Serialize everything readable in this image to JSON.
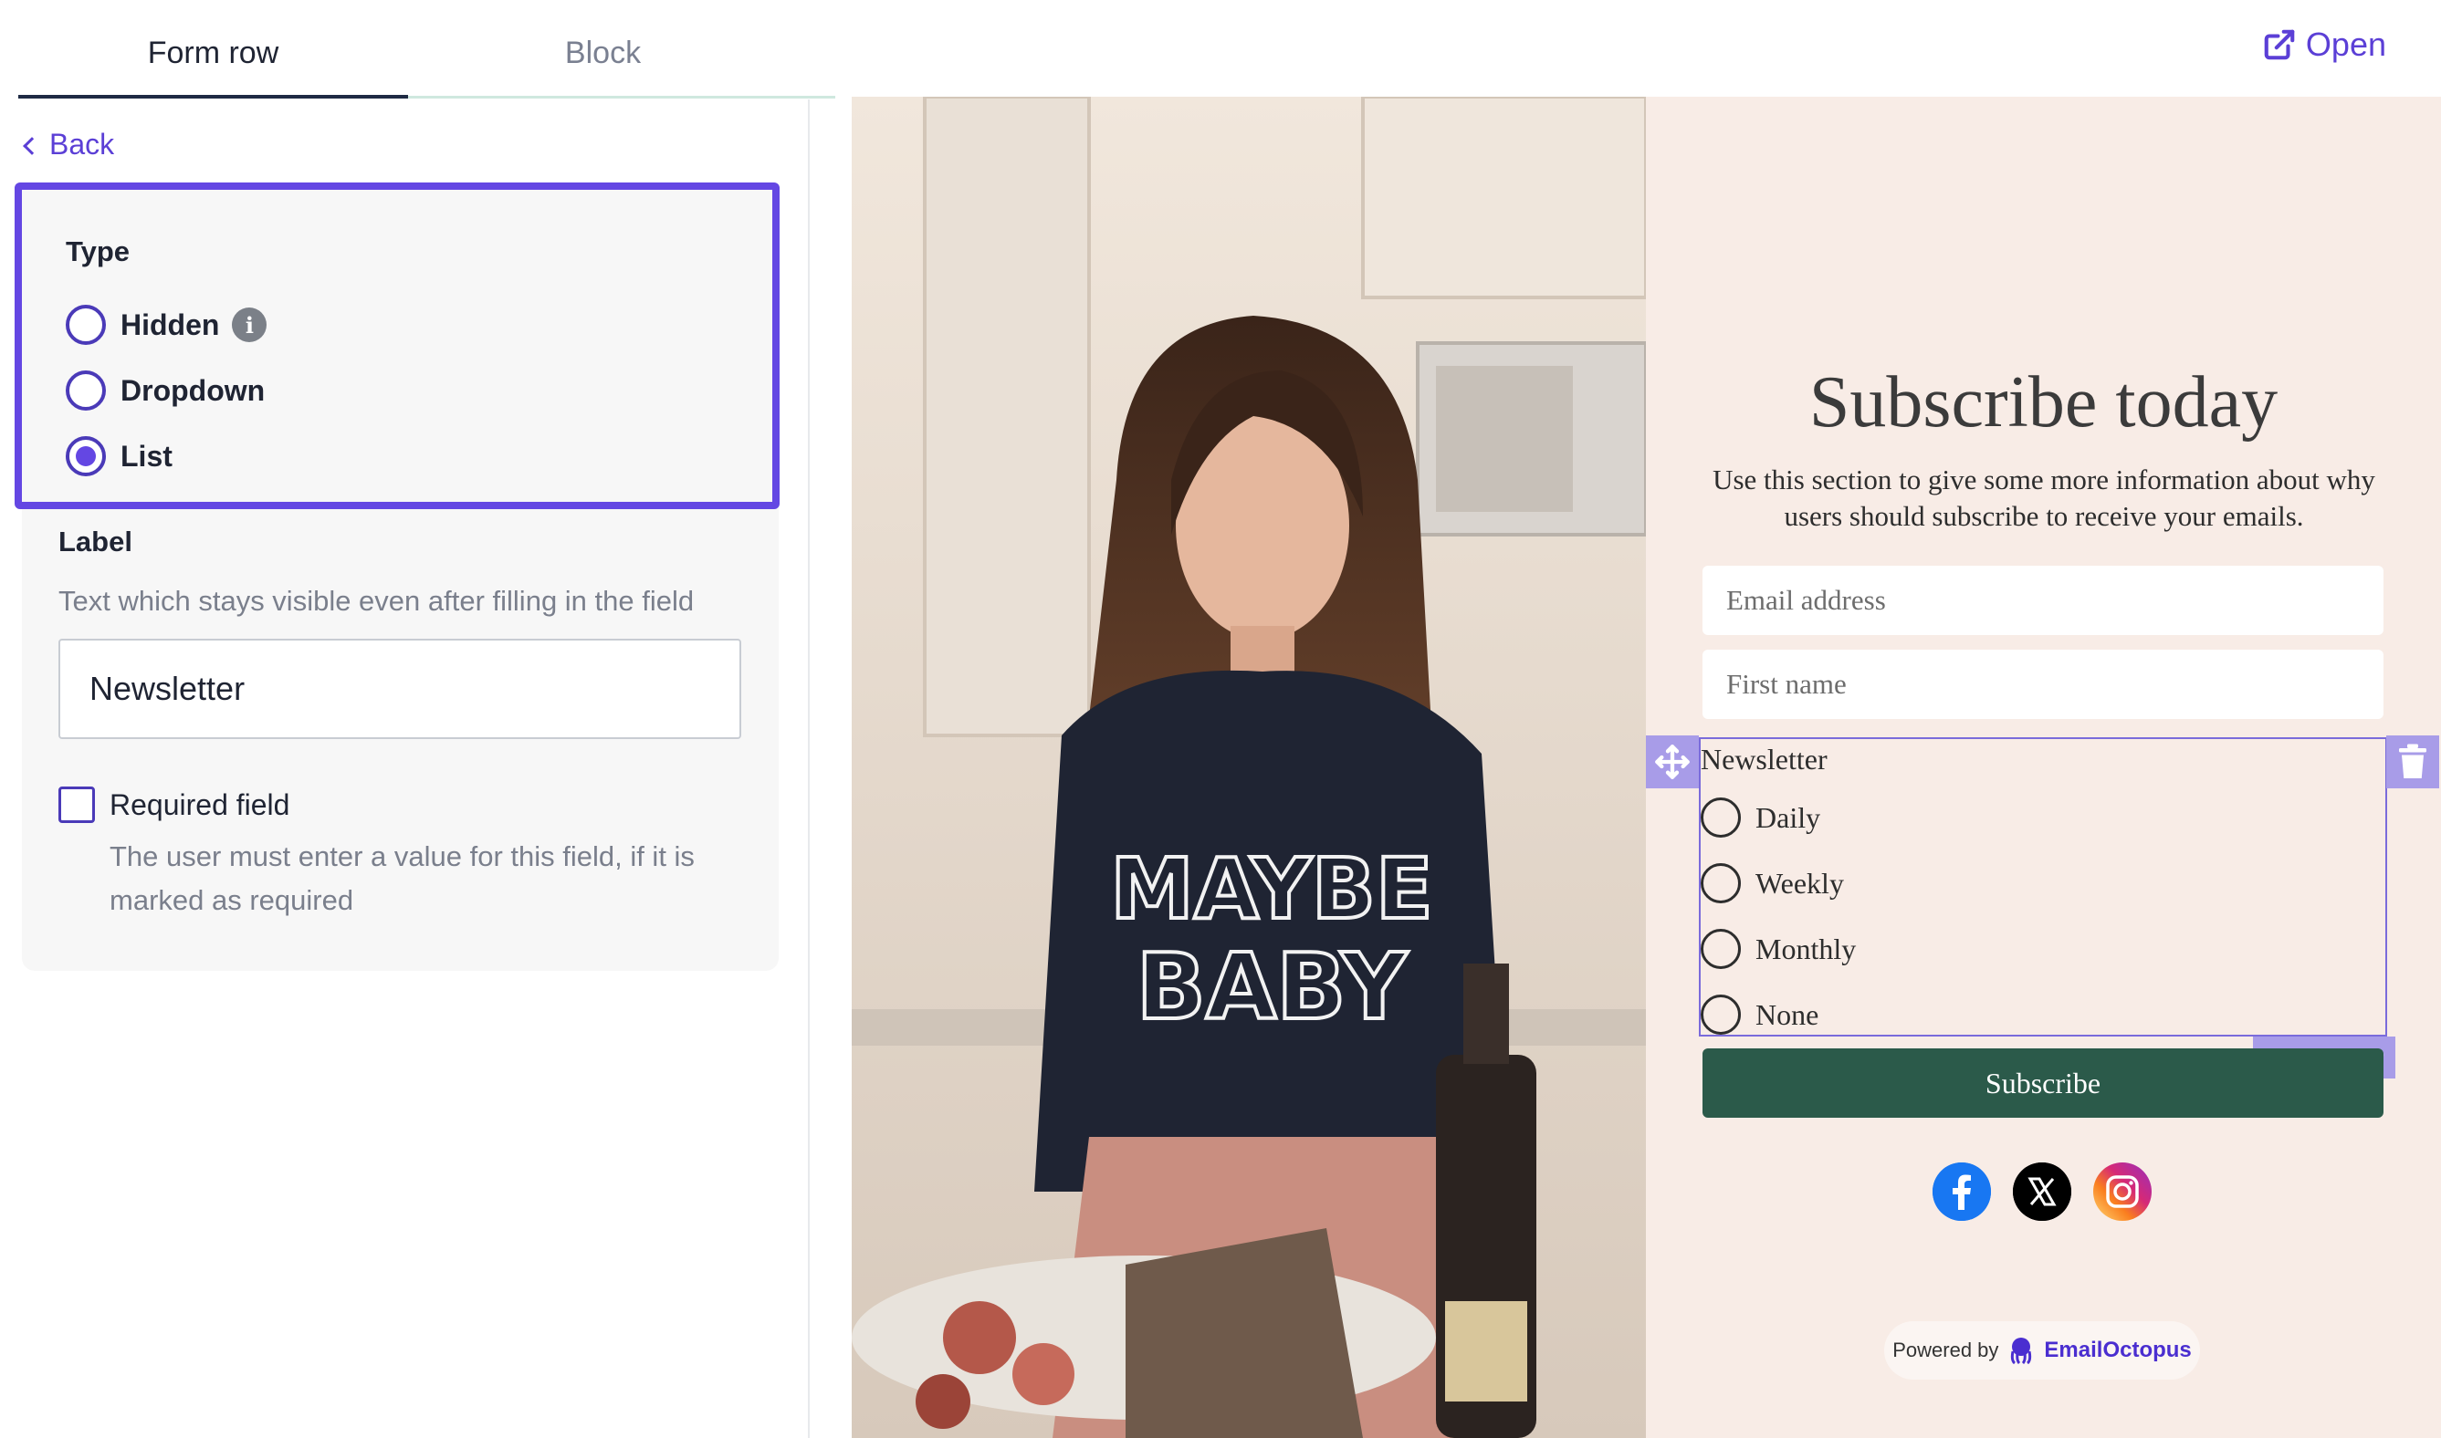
{
  "tabs": [
    {
      "label": "Form row",
      "active": true
    },
    {
      "label": "Block",
      "active": false
    }
  ],
  "back_label": "Back",
  "open_label": "Open",
  "type_section": {
    "title": "Type",
    "options": [
      {
        "label": "Hidden",
        "checked": false,
        "has_info": true
      },
      {
        "label": "Dropdown",
        "checked": false
      },
      {
        "label": "List",
        "checked": true
      }
    ]
  },
  "label_section": {
    "title": "Label",
    "help": "Text which stays visible even after filling in the field",
    "value": "Newsletter"
  },
  "required": {
    "label": "Required field",
    "checked": false,
    "help": "The user must enter a value for this field, if it is marked as required"
  },
  "preview": {
    "title": "Subscribe today",
    "description": "Use this section to give some more information about why users should subscribe to receive your emails.",
    "email_placeholder": "Email address",
    "firstname_placeholder": "First name",
    "newsletter_label": "Newsletter",
    "newsletter_options": [
      "Daily",
      "Weekly",
      "Monthly",
      "None"
    ],
    "field_tag": "Newsletter",
    "subscribe_label": "Subscribe",
    "powered_by": "Powered by",
    "brand": "EmailOctopus",
    "photo_text_line1": "MAYBE",
    "photo_text_line2": "BABY"
  },
  "colors": {
    "accent": "#6447e3",
    "button": "#2b5a4a",
    "form_bg": "#f8ece6",
    "facebook": "#1877f2",
    "x": "#000000"
  },
  "icons": {
    "move": "move-arrows-icon",
    "trash": "trash-icon",
    "info": "info-icon",
    "open": "external-link-icon",
    "social": [
      "facebook-icon",
      "x-icon",
      "instagram-icon"
    ]
  }
}
